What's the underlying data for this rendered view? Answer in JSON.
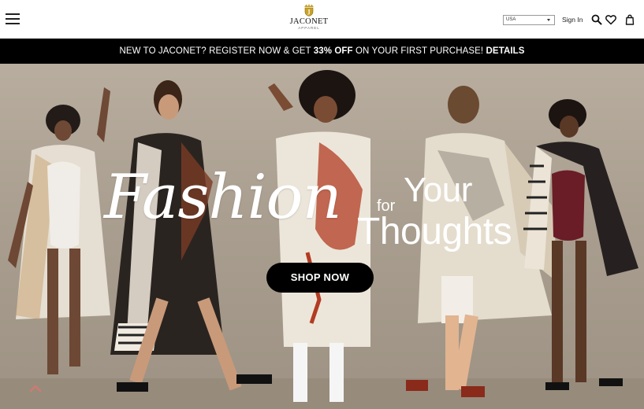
{
  "header": {
    "menu_icon": "hamburger-icon",
    "logo": {
      "name": "JACONET",
      "sub": "APPAREL"
    },
    "country_select": {
      "value": "USA"
    },
    "sign_in_label": "Sign In",
    "icons": [
      "search-icon",
      "heart-icon",
      "shopping-bag-icon"
    ]
  },
  "promo": {
    "prefix": "NEW TO JACONET? REGISTER NOW & GET ",
    "highlight": "33% OFF",
    "middle": " ON YOUR FIRST PURCHASE! ",
    "link": "DETAILS"
  },
  "hero": {
    "headline_script": "Fashion",
    "headline_for": "for",
    "headline_your": "Your",
    "headline_thoughts": "Thoughts",
    "cta_label": "SHOP NOW"
  },
  "colors": {
    "promo_bg": "#000000",
    "cta_bg": "#000000",
    "hero_bg": "#b0a596"
  }
}
